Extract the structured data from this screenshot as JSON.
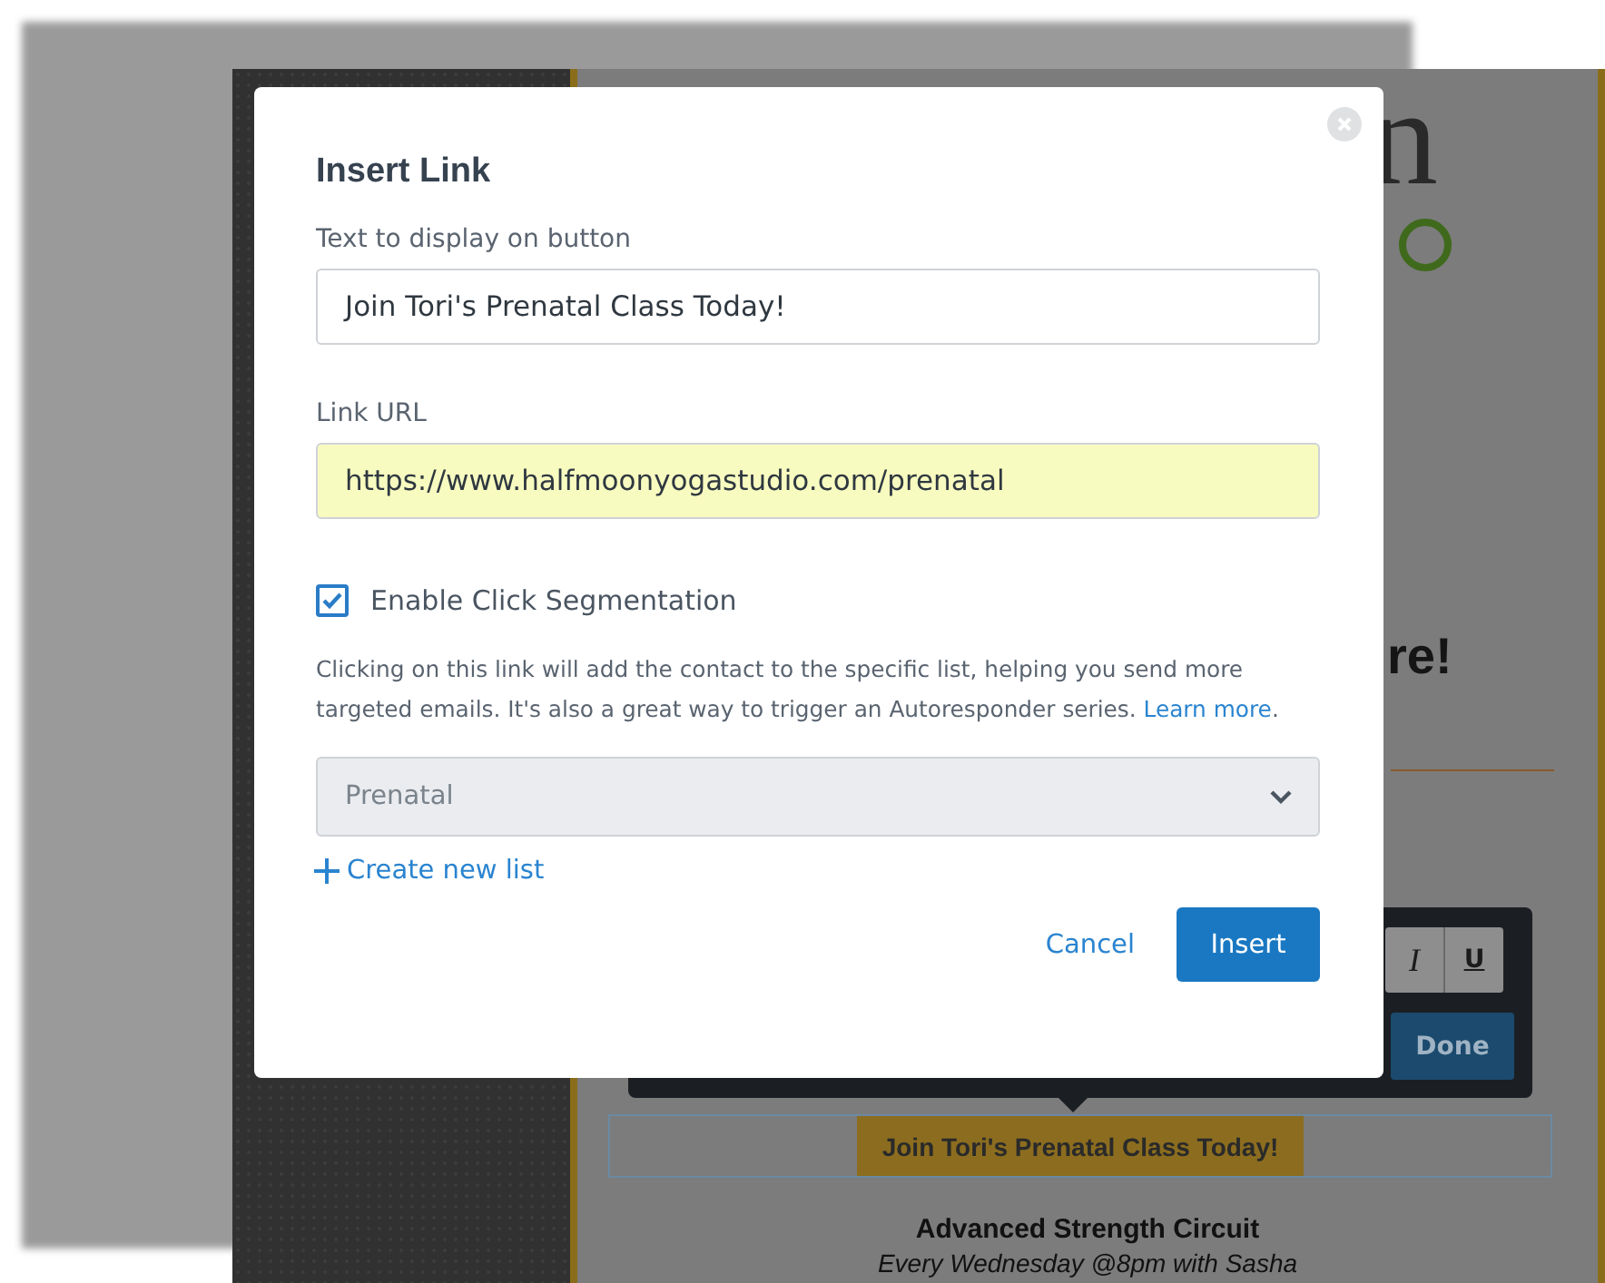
{
  "background": {
    "logo_fragment": "n",
    "heading_fragment": "re!",
    "toolbar": {
      "buttons": [
        {
          "label": "I",
          "kind": "italic"
        },
        {
          "label": "U",
          "kind": "underline"
        }
      ],
      "done": "Done"
    },
    "email_button": "Join Tori's Prenatal Class Today!",
    "class_title": "Advanced Strength Circuit",
    "class_schedule": "Every Wednesday @8pm with Sasha"
  },
  "dialog": {
    "title": "Insert Link",
    "fields": [
      {
        "label": "Text to display on button",
        "value": "Join Tori's Prenatal Class Today!",
        "highlighted": false
      },
      {
        "label": "Link URL",
        "value": "https://www.halfmoonyogastudio.com/prenatal",
        "highlighted": true
      }
    ],
    "checkbox": {
      "label": "Enable Click Segmentation",
      "checked": true
    },
    "help": {
      "text": "Clicking on this link will add the contact to the specific list, helping you send more targeted emails. It's also a great way to trigger an Autoresponder series. ",
      "link": "Learn more",
      "after": "."
    },
    "select": {
      "value": "Prenatal"
    },
    "create_list": "Create new list",
    "buttons": [
      {
        "label": "Cancel",
        "kind": "link"
      },
      {
        "label": "Insert",
        "kind": "primary"
      }
    ]
  }
}
